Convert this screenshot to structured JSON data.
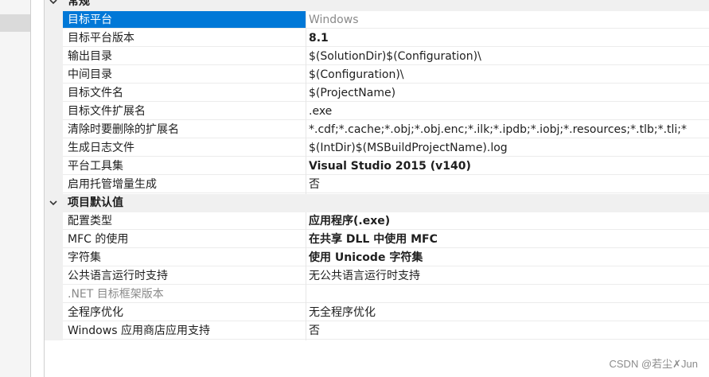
{
  "categories": [
    {
      "label": "常规",
      "rows": [
        {
          "name": "目标平台",
          "value": "Windows",
          "style": "muted",
          "selected": true
        },
        {
          "name": "目标平台版本",
          "value": "8.1",
          "style": "bold"
        },
        {
          "name": "输出目录",
          "value": "$(SolutionDir)$(Configuration)\\",
          "style": "normal"
        },
        {
          "name": "中间目录",
          "value": "$(Configuration)\\",
          "style": "normal"
        },
        {
          "name": "目标文件名",
          "value": "$(ProjectName)",
          "style": "normal"
        },
        {
          "name": "目标文件扩展名",
          "value": ".exe",
          "style": "normal"
        },
        {
          "name": "清除时要删除的扩展名",
          "value": "*.cdf;*.cache;*.obj;*.obj.enc;*.ilk;*.ipdb;*.iobj;*.resources;*.tlb;*.tli;*",
          "style": "normal"
        },
        {
          "name": "生成日志文件",
          "value": "$(IntDir)$(MSBuildProjectName).log",
          "style": "normal"
        },
        {
          "name": "平台工具集",
          "value": "Visual Studio 2015 (v140)",
          "style": "bold"
        },
        {
          "name": "启用托管增量生成",
          "value": "否",
          "style": "normal"
        }
      ]
    },
    {
      "label": "项目默认值",
      "rows": [
        {
          "name": "配置类型",
          "value": "应用程序(.exe)",
          "style": "bold"
        },
        {
          "name": "MFC 的使用",
          "value": "在共享 DLL 中使用 MFC",
          "style": "bold"
        },
        {
          "name": "字符集",
          "value": "使用 Unicode 字符集",
          "style": "bold"
        },
        {
          "name": "公共语言运行时支持",
          "value": "无公共语言运行时支持",
          "style": "normal"
        },
        {
          "name": ".NET 目标框架版本",
          "value": "",
          "style": "normal",
          "disabled": true
        },
        {
          "name": "全程序优化",
          "value": "无全程序优化",
          "style": "normal"
        },
        {
          "name": "Windows 应用商店应用支持",
          "value": "否",
          "style": "normal"
        }
      ]
    }
  ],
  "watermark": "CSDN @若尘✗Jun",
  "icons": {
    "collapse": "chevron-down-icon"
  },
  "colors": {
    "selection": "#0078d7",
    "category_bg": "#f0f0f0"
  }
}
